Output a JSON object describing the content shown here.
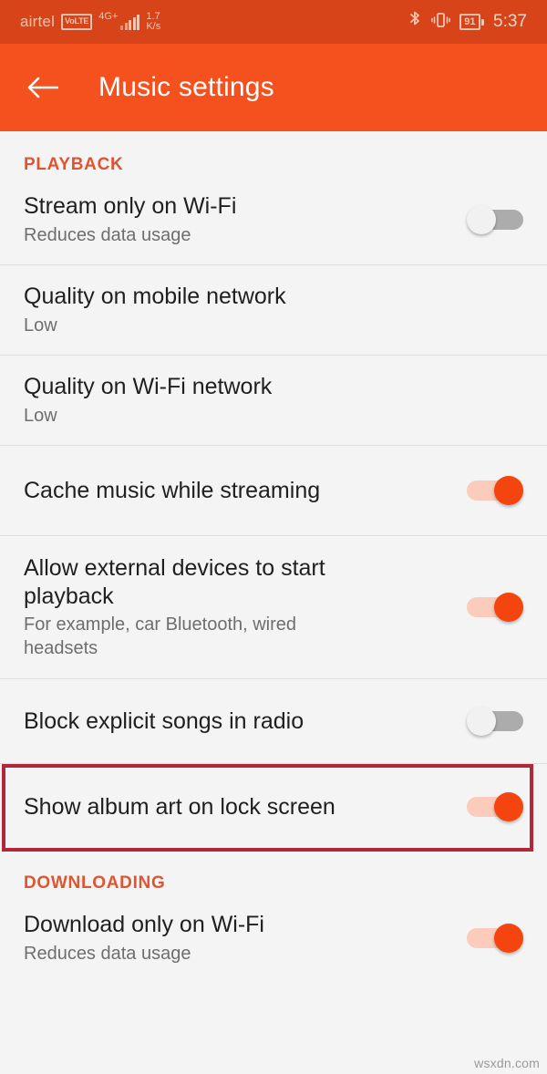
{
  "status_bar": {
    "carrier": "airtel",
    "volte_badge": "VoLTE",
    "network_type": "4G+",
    "data_speed_value": "1.7",
    "data_speed_unit": "K/s",
    "bluetooth_icon": "bluetooth-icon",
    "vibrate_icon": "vibrate-icon",
    "battery_percent": "91",
    "time": "5:37"
  },
  "app_bar": {
    "back_icon": "back-arrow-icon",
    "title": "Music settings"
  },
  "sections": [
    {
      "header": "PLAYBACK",
      "rows": [
        {
          "title": "Stream only on Wi-Fi",
          "subtitle": "Reduces data usage",
          "control": "switch",
          "state": "off"
        },
        {
          "title": "Quality on mobile network",
          "subtitle": "Low",
          "control": "none",
          "state": ""
        },
        {
          "title": "Quality on Wi-Fi network",
          "subtitle": "Low",
          "control": "none",
          "state": ""
        },
        {
          "title": "Cache music while streaming",
          "subtitle": "",
          "control": "switch",
          "state": "on"
        },
        {
          "title": "Allow external devices to start playback",
          "subtitle": "For example, car Bluetooth, wired headsets",
          "control": "switch",
          "state": "on"
        },
        {
          "title": "Block explicit songs in radio",
          "subtitle": "",
          "control": "switch",
          "state": "off",
          "highlighted": true
        },
        {
          "title": "Show album art on lock screen",
          "subtitle": "",
          "control": "switch",
          "state": "on"
        }
      ]
    },
    {
      "header": "DOWNLOADING",
      "rows": [
        {
          "title": "Download only on Wi-Fi",
          "subtitle": "Reduces data usage",
          "control": "switch",
          "state": "on"
        }
      ]
    }
  ],
  "annotation": {
    "highlight_target": "Block explicit songs in radio",
    "border_color": "#B1283A"
  },
  "watermark": "wsxdn.com",
  "colors": {
    "status_bar": "#D8441A",
    "app_bar": "#F4511E",
    "section_header": "#E0542F",
    "switch_on_knob": "#F4450F",
    "switch_on_track": "#FBCBBB",
    "switch_off_track": "#ACACAC",
    "background": "#F4F4F4"
  }
}
